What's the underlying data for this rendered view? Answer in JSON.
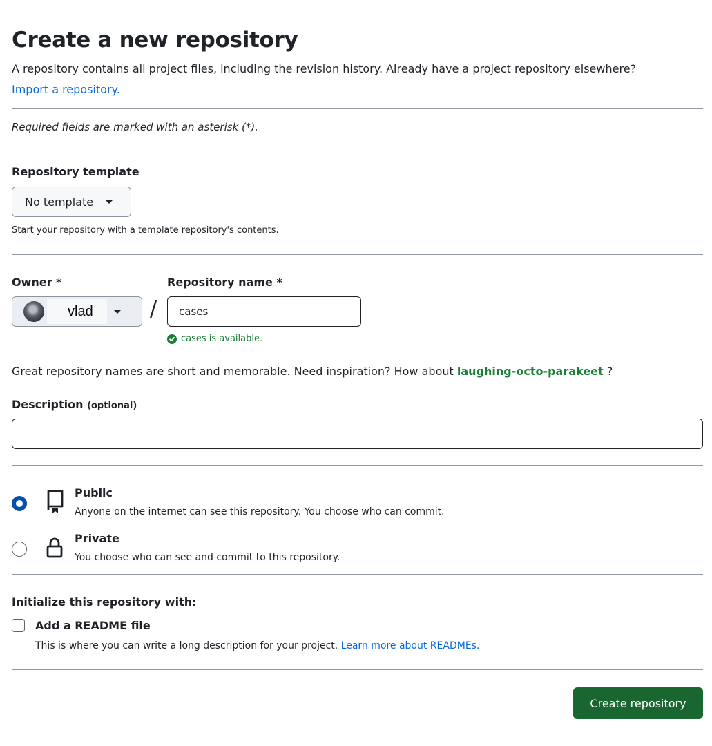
{
  "header": {
    "title": "Create a new repository",
    "intro": "A repository contains all project files, including the revision history. Already have a project repository elsewhere?",
    "import_link": "Import a repository."
  },
  "required_note": "Required fields are marked with an asterisk (*).",
  "template": {
    "label": "Repository template",
    "selected": "No template",
    "hint": "Start your repository with a template repository's contents."
  },
  "owner": {
    "label": "Owner *",
    "value": "vlad"
  },
  "repo_name": {
    "label": "Repository name *",
    "value": "cases",
    "availability": "cases is available."
  },
  "separator": "/",
  "suggestion": {
    "text": "Great repository names are short and memorable. Need inspiration? How about",
    "name": "laughing-octo-parakeet",
    "suffix": "?"
  },
  "description": {
    "label": "Description",
    "optional": "(optional)",
    "value": ""
  },
  "visibility": {
    "selected": "public",
    "public": {
      "title": "Public",
      "desc": "Anyone on the internet can see this repository. You choose who can commit."
    },
    "private": {
      "title": "Private",
      "desc": "You choose who can see and commit to this repository."
    }
  },
  "initialize": {
    "label": "Initialize this repository with:",
    "readme": {
      "label": "Add a README file",
      "desc": "This is where you can write a long description for your project.",
      "link": "Learn more about READMEs.",
      "checked": false
    }
  },
  "submit": {
    "label": "Create repository"
  },
  "icons": {
    "caret": "triangle-down-icon",
    "check": "check-circle-icon",
    "public": "repo-icon",
    "private": "lock-icon",
    "avatar": "avatar"
  },
  "colors": {
    "link": "#0969da",
    "success": "#1a7f37",
    "primary_button": "#1a6630",
    "radio_selected": "#0550ae"
  }
}
